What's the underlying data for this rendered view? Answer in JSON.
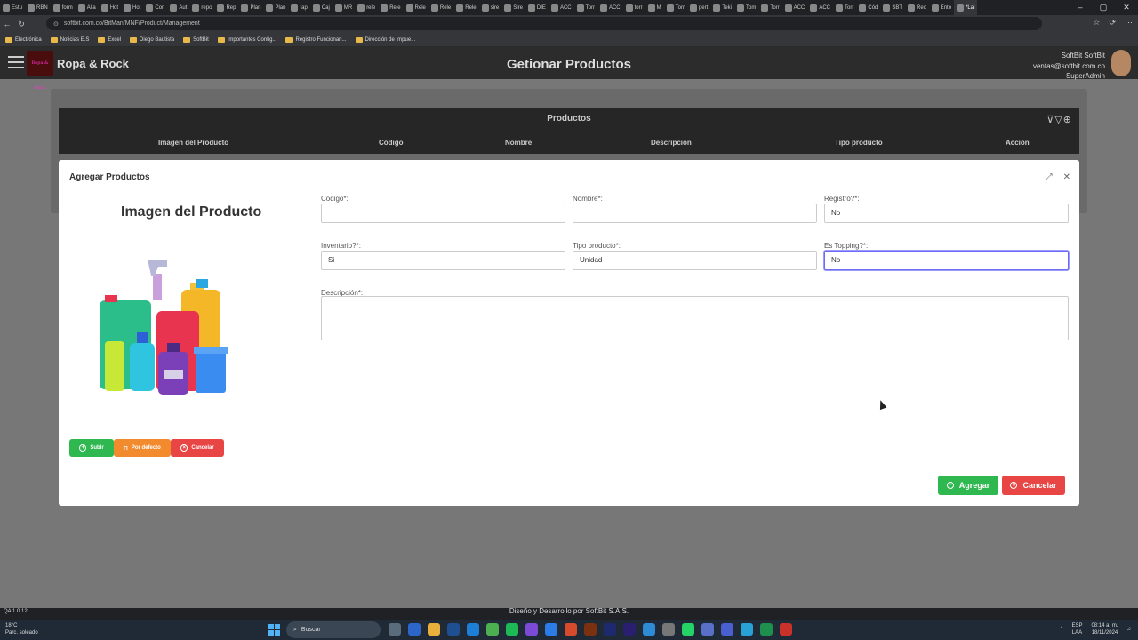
{
  "browser": {
    "tabs": [
      "Estu",
      "RBN",
      "form",
      "Alia",
      "Hot",
      "Hot",
      "Con",
      "Aut",
      "repo",
      "Rep",
      "Plan",
      "Plan",
      "tap",
      "Caj",
      "MR",
      "rele",
      "Rele",
      "Rele",
      "Rele",
      "Rele",
      "sire",
      "Sire",
      "DIE",
      "ACC",
      "Torr",
      "ACC",
      "torr",
      "M",
      "Torr",
      "pert",
      "Teki",
      "Tom",
      "Torr",
      "ACC",
      "ACC",
      "Torr",
      "Cód",
      "SBT",
      "Rec",
      "Ento",
      "*Lal"
    ],
    "url": "softbit.com.co/BitMan/MNF/Product/Management",
    "bookmarks": [
      "Electrónica",
      "Noticias E.S",
      "Excel",
      "Diego Bautista",
      "SoftBit",
      "Importantes Config...",
      "Registro Funcionari...",
      "Dirección de Impue..."
    ]
  },
  "app": {
    "brand": "Ropa & Rock",
    "logo_text": "Ropa & Rock",
    "page_title": "Getionar Productos",
    "user_name": "SoftBit SoftBit",
    "user_email": "ventas@softbit.com.co",
    "user_role": "SuperAdmin"
  },
  "table": {
    "title": "Productos",
    "columns": [
      "Imagen del Producto",
      "Código",
      "Nombre",
      "Descripción",
      "Tipo producto",
      "Acción"
    ]
  },
  "modal": {
    "title": "Agregar Productos",
    "image_title": "Imagen del Producto",
    "upload_btn": "Subir",
    "default_btn": "Por defecto",
    "cancel_small_btn": "Cancelar",
    "fields": {
      "codigo_label": "Código*:",
      "codigo_value": "",
      "nombre_label": "Nombre*:",
      "nombre_value": "",
      "registro_label": "Registro?*:",
      "registro_value": "No",
      "inventario_label": "Inventario?*:",
      "inventario_value": "Si",
      "tipo_label": "Tipo producto*:",
      "tipo_value": "Unidad",
      "topping_label": "Es Topping?*:",
      "topping_value": "No",
      "descripcion_label": "Descripción*:",
      "descripcion_value": ""
    },
    "add_btn": "Agregar",
    "cancel_btn": "Cancelar"
  },
  "footer": {
    "text": "Diseño y Desarrollo por SoftBit S.A.S.",
    "version": "QA 1.0.12"
  },
  "taskbar": {
    "weather_temp": "18°C",
    "weather_desc": "Parc. soleado",
    "search": "Buscar",
    "lang": "ESP",
    "lang2": "LAA",
    "time": "08:14 a. m.",
    "date": "18/11/2024"
  },
  "colors": {
    "green": "#2fb84f",
    "orange": "#f28a2e",
    "red": "#e84545",
    "appbar": "#2c2c2c"
  }
}
